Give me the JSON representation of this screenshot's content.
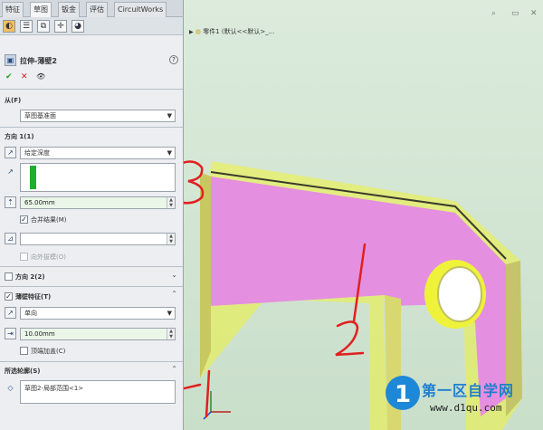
{
  "tabs": [
    "特征",
    "草图",
    "钣金",
    "评估",
    "CircuitWorks"
  ],
  "feature": {
    "title": "拉伸-薄壁2",
    "help": "?",
    "ok": "✔",
    "cancel": "✕",
    "preview": "👁"
  },
  "from": {
    "label": "从(F)",
    "value": "草图基准面"
  },
  "direction1": {
    "label": "方向 1(1)",
    "end_condition": "给定深度",
    "depth": "65.00mm",
    "merge_label": "合并结果(M)",
    "merge_checked": true,
    "draft_label": "向外拔模(O)"
  },
  "direction2": {
    "label": "方向 2(2)"
  },
  "thin": {
    "label": "薄壁特征(T)",
    "checked": true,
    "type": "单向",
    "thickness": "10.00mm",
    "cap_label": "顶端加盖(C)"
  },
  "contours": {
    "label": "所选轮廓(S)",
    "item": "草图2-局部范围<1>"
  },
  "tree": {
    "item": "零件1 (默认<<默认>_..."
  },
  "annotations": {
    "one": "1",
    "two": "2",
    "three": "3",
    "color": "#e02020"
  },
  "watermark": {
    "text": "第一区自学网",
    "url": "www.d1qu.com",
    "logo_letter": "1"
  },
  "colors": {
    "face": "#e58fe0",
    "highlight": "#eef23a",
    "accent_green": "#1fae2d"
  }
}
